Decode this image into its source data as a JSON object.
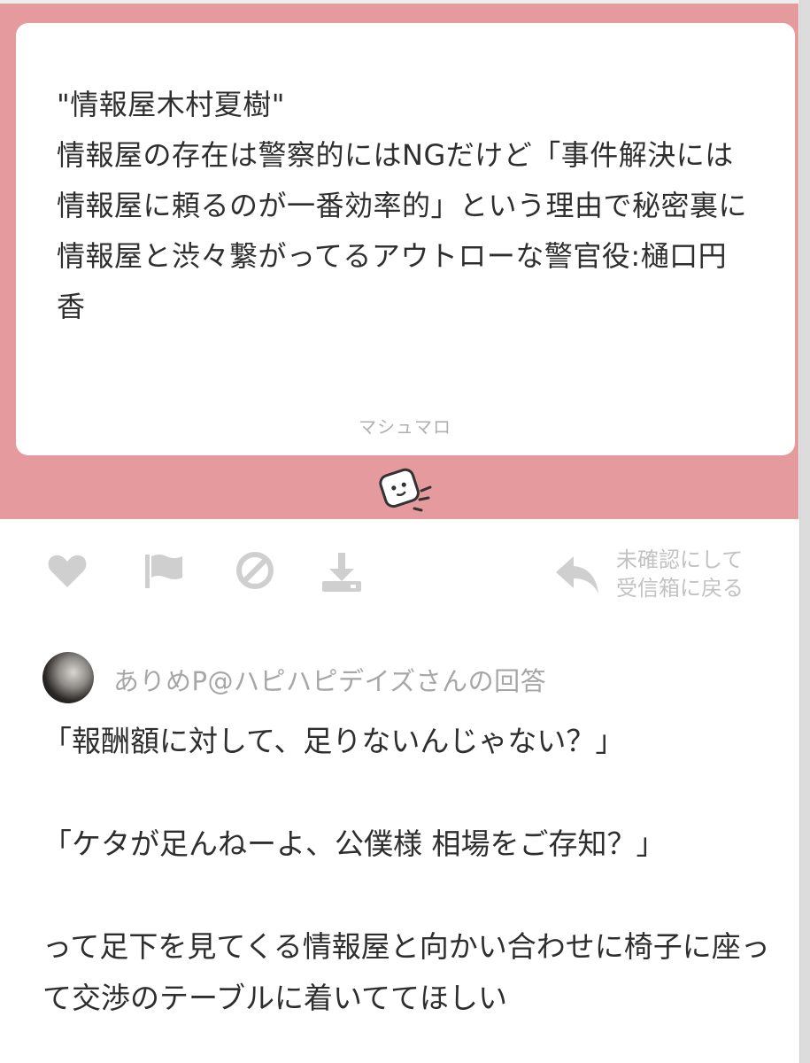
{
  "question": {
    "text": "\"情報屋木村夏樹\"\n情報屋の存在は警察的にはNGだけど「事件解決には情報屋に頼るのが一番効率的」という理由で秘密裏に情報屋と渋々繋がってるアウトローな警官役:樋口円香"
  },
  "brand": {
    "label": "マシュマロ"
  },
  "actions": {
    "back_label": "未確認にして\n受信箱に戻る",
    "icons": [
      "heart-icon",
      "flag-icon",
      "block-icon",
      "download-icon",
      "reply-icon"
    ]
  },
  "answer": {
    "author_label": "ありめP@ハピハピデイズさんの回答",
    "text": "「報酬額に対して、足りないんじゃない？」\n\n「ケタが足んねーよ、公僕様 相場をご存知？」\n\nって足下を見てくる情報屋と向かい合わせに椅子に座って交渉のテーブルに着いててほしい"
  },
  "colors": {
    "banner": "#e59b9e",
    "card": "#ffffff",
    "icon_gray": "#cfcfcf",
    "text": "#2e2e2e"
  }
}
